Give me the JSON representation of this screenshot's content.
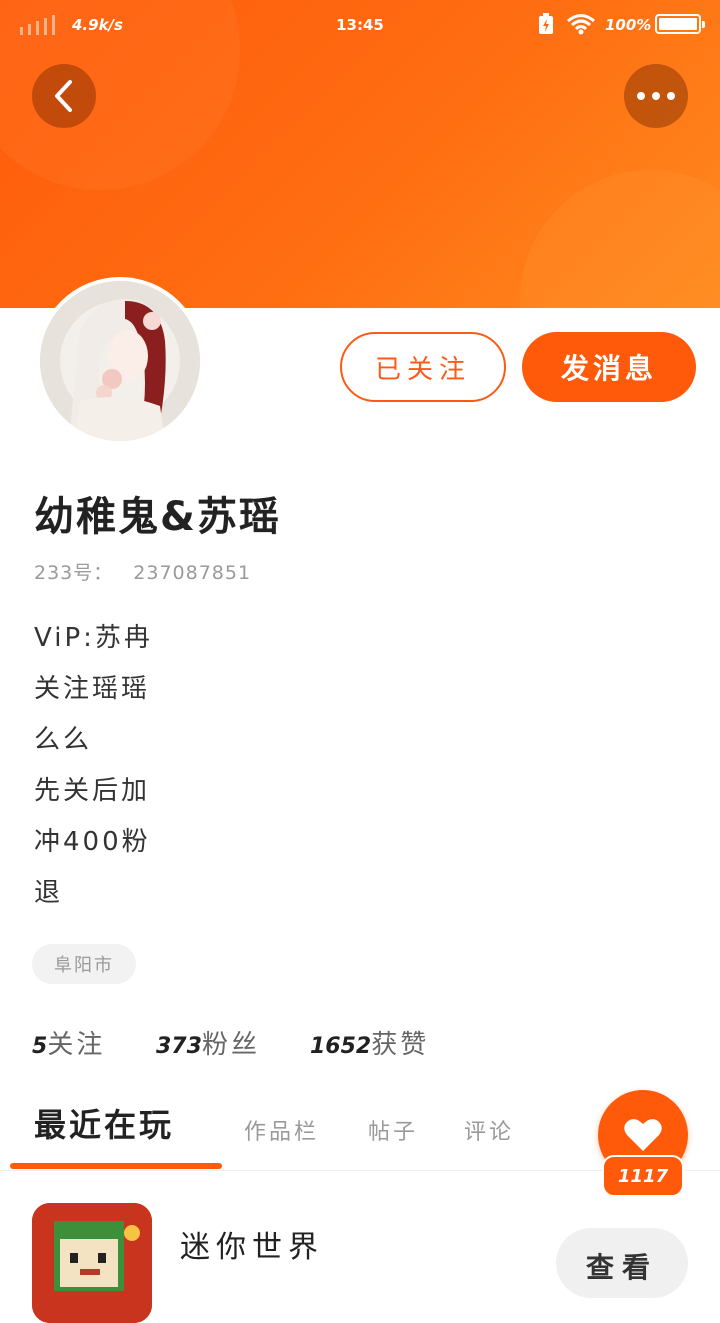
{
  "status_bar": {
    "net_speed": "4.9k/s",
    "time": "13:45",
    "battery_pct": "100%",
    "battery_level": 1.0
  },
  "header": {
    "back_icon": "chevron-left-icon",
    "more_icon": "more-dots-icon",
    "banner_color": "#ff6a10"
  },
  "profile": {
    "followed_label": "已关注",
    "message_label": "发消息",
    "username": "幼稚鬼&苏瑶",
    "uid_label": "233号：",
    "uid_value": "237087851",
    "bio": [
      "ViP:苏冉",
      "关注瑶瑶",
      "么么",
      "先关后加",
      "冲400粉",
      "退"
    ],
    "location": "阜阳市"
  },
  "stats": [
    {
      "value": "5",
      "label": "关注"
    },
    {
      "value": "373",
      "label": "粉丝"
    },
    {
      "value": "1652",
      "label": "获赞"
    }
  ],
  "tabs": [
    {
      "label": "最近在玩",
      "active": true
    },
    {
      "label": "作品栏",
      "active": false
    },
    {
      "label": "帖子",
      "active": false
    },
    {
      "label": "评论",
      "active": false
    }
  ],
  "like": {
    "icon": "heart-icon",
    "count": "1117"
  },
  "recent_game": {
    "title": "迷你世界",
    "view_label": "查看"
  },
  "accent_color": "#ff5a0a"
}
